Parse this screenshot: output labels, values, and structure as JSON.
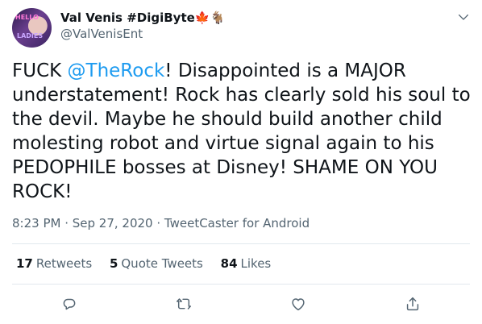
{
  "author": {
    "display_name": "Val Venis #DigiByte",
    "badges": "🍁🐐",
    "handle": "@ValVenisEnt",
    "avatar_text_top": "HELLO",
    "avatar_text_bottom": "LADIES"
  },
  "tweet": {
    "part1": "FUCK ",
    "mention": "@TheRock",
    "part2": "! Disappointed is a MAJOR understatement! Rock has clearly sold his soul to the devil. Maybe he should build another child molesting robot and virtue signal again to his PEDOPHILE bosses at Disney! SHAME ON YOU ROCK!"
  },
  "meta": {
    "time": "8:23 PM",
    "sep1": " · ",
    "date": "Sep 27, 2020",
    "sep2": " · ",
    "source": "TweetCaster for Android"
  },
  "stats": {
    "retweets": {
      "count": "17",
      "label": "Retweets"
    },
    "quotes": {
      "count": "5",
      "label": "Quote Tweets"
    },
    "likes": {
      "count": "84",
      "label": "Likes"
    }
  },
  "colors": {
    "accent": "#1d9bf0",
    "muted": "#536471",
    "text": "#0f1419"
  },
  "icons": [
    "chevron-down-icon",
    "reply-icon",
    "retweet-icon",
    "like-icon",
    "share-icon"
  ]
}
